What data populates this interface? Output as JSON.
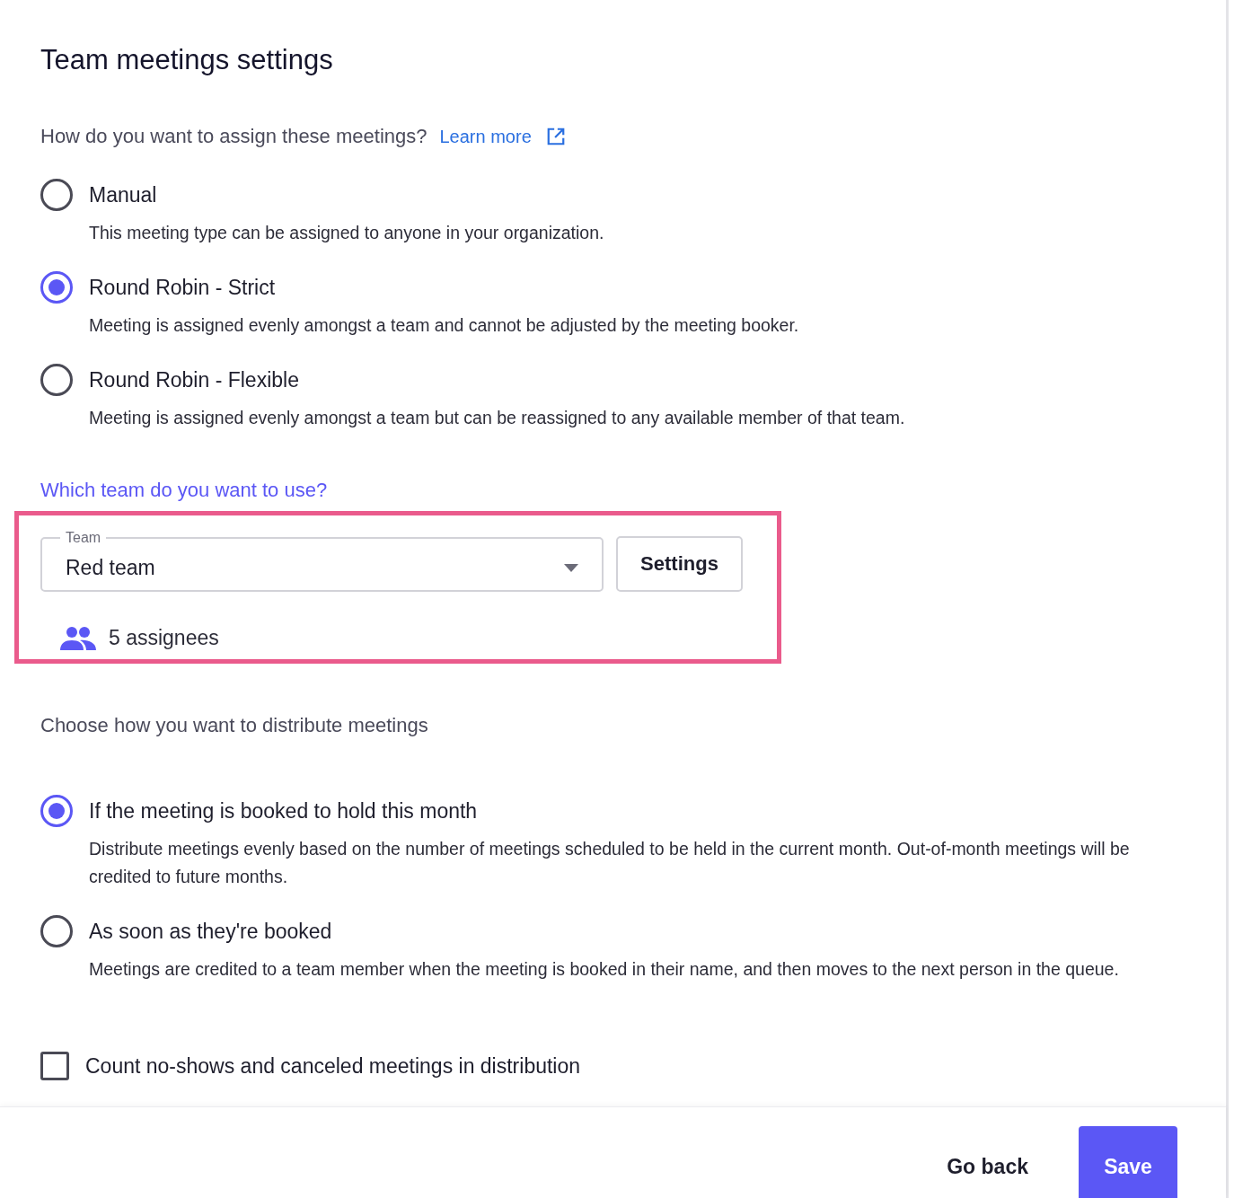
{
  "title": "Team meetings settings",
  "assignment": {
    "question": "How do you want to assign these meetings?",
    "learn_more": "Learn more",
    "options": [
      {
        "label": "Manual",
        "description": "This meeting type can be assigned to anyone in your organization.",
        "selected": false
      },
      {
        "label": "Round Robin - Strict",
        "description": "Meeting is assigned evenly amongst a team and cannot be adjusted by the meeting booker.",
        "selected": true
      },
      {
        "label": "Round Robin - Flexible",
        "description": "Meeting is assigned evenly amongst a team but can be reassigned to any available member of that team.",
        "selected": false
      }
    ]
  },
  "team": {
    "question": "Which team do you want to use?",
    "highlighted": true,
    "field": {
      "label": "Team",
      "value": "Red team"
    },
    "settings_button": "Settings",
    "assignees": "5 assignees"
  },
  "distribution": {
    "question": "Choose how you want to distribute meetings",
    "options": [
      {
        "label": "If the meeting is booked to hold this month",
        "description": "Distribute meetings evenly based on the number of meetings scheduled to be held in the current month. Out-of-month meetings will be credited to future months.",
        "selected": true
      },
      {
        "label": "As soon as they're booked",
        "description": "Meetings are credited to a team member when the meeting is booked in their name, and then moves to the next person in the queue.",
        "selected": false
      }
    ]
  },
  "count_no_shows": {
    "label": "Count no-shows and canceled meetings in distribution",
    "checked": false
  },
  "footer": {
    "buttons": [
      {
        "label": "Go back",
        "kind": "text"
      },
      {
        "label": "Save",
        "kind": "primary"
      }
    ]
  }
}
